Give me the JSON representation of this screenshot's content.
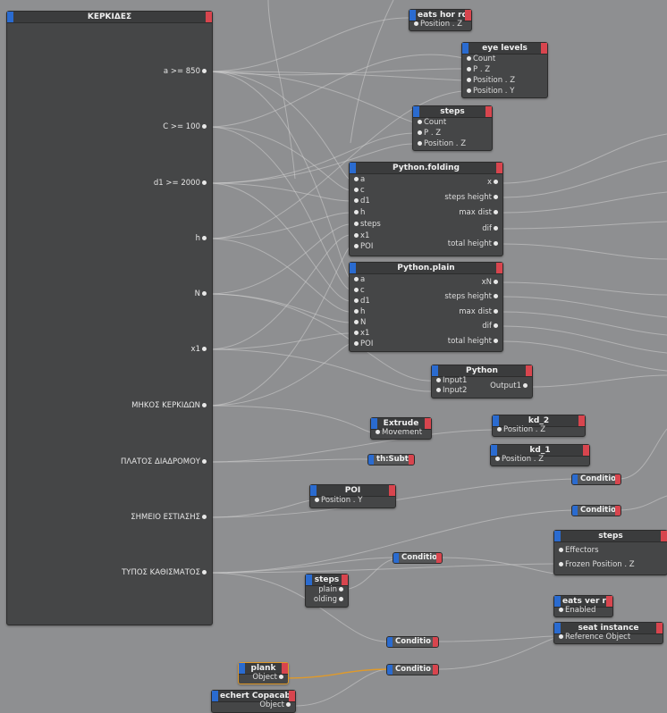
{
  "kerkides": {
    "title": "ΚΕΡΚΙΔΕΣ",
    "ports": [
      "a >= 850",
      "C >= 100",
      "d1 >= 2000",
      "h",
      "N",
      "x1",
      "ΜΗΚΟΣ ΚΕΡΚΙΔΩΝ",
      "ΠΛΑΤΟΣ ΔΙΑΔΡΟΜΟΥ",
      "ΣΗΜΕΙΟ ΕΣΤΙΑΣΗΣ",
      "ΤΥΠΟΣ ΚΑΘΙΣΜΑΤΟΣ"
    ]
  },
  "seats_hor": {
    "title": "eats hor rov",
    "in": [
      "Position . Z"
    ]
  },
  "eye_levels": {
    "title": "eye levels",
    "in": [
      "Count",
      "P . Z",
      "Position . Z",
      "Position . Y"
    ]
  },
  "steps_top": {
    "title": "steps",
    "in": [
      "Count",
      "P . Z",
      "Position . Z"
    ]
  },
  "py_folding": {
    "title": "Python.folding",
    "in": [
      "a",
      "c",
      "d1",
      "h",
      "steps",
      "x1",
      "POI"
    ],
    "out": [
      "x",
      "steps height",
      "max dist",
      "dif",
      "total height"
    ]
  },
  "py_plain": {
    "title": "Python.plain",
    "in": [
      "a",
      "c",
      "d1",
      "h",
      "N",
      "x1",
      "POI"
    ],
    "out": [
      "xN",
      "steps height",
      "max dist",
      "dif",
      "total height"
    ]
  },
  "python": {
    "title": "Python",
    "in": [
      "Input1",
      "Input2"
    ],
    "out": [
      "Output1"
    ]
  },
  "extrude": {
    "title": "Extrude",
    "in": [
      "Movement"
    ]
  },
  "kd2": {
    "title": "kd_2",
    "in": [
      "Position . Z"
    ]
  },
  "kd1": {
    "title": "kd_1",
    "in": [
      "Position . Z"
    ]
  },
  "math_sub": {
    "title": "th:Subtr"
  },
  "poi": {
    "title": "POI",
    "in": [
      "Position . Y"
    ]
  },
  "cond1": {
    "title": "Conditio"
  },
  "cond2": {
    "title": "Conditio"
  },
  "cond3": {
    "title": "Conditio"
  },
  "cond4": {
    "title": "Conditio"
  },
  "cond5": {
    "title": "Conditio"
  },
  "steps_eff": {
    "title": "steps",
    "in": [
      "Effectors",
      "Frozen Position . Z"
    ]
  },
  "steps_small": {
    "title": "steps",
    "out": [
      "plain",
      "olding"
    ]
  },
  "seats_ver": {
    "title": "eats ver rov",
    "in": [
      "Enabled"
    ]
  },
  "seat_instance": {
    "title": "seat instance",
    "in": [
      "Reference Object"
    ]
  },
  "plank": {
    "title": "plank",
    "out": [
      "Object"
    ]
  },
  "copacabana": {
    "title": "echert Copacabar",
    "out": [
      "Object"
    ]
  },
  "colors": {
    "header_left": "#2a6bd0",
    "header_right": "#d8454e",
    "wire": "#c8c8c8",
    "selected_wire": "#e09a2a"
  }
}
